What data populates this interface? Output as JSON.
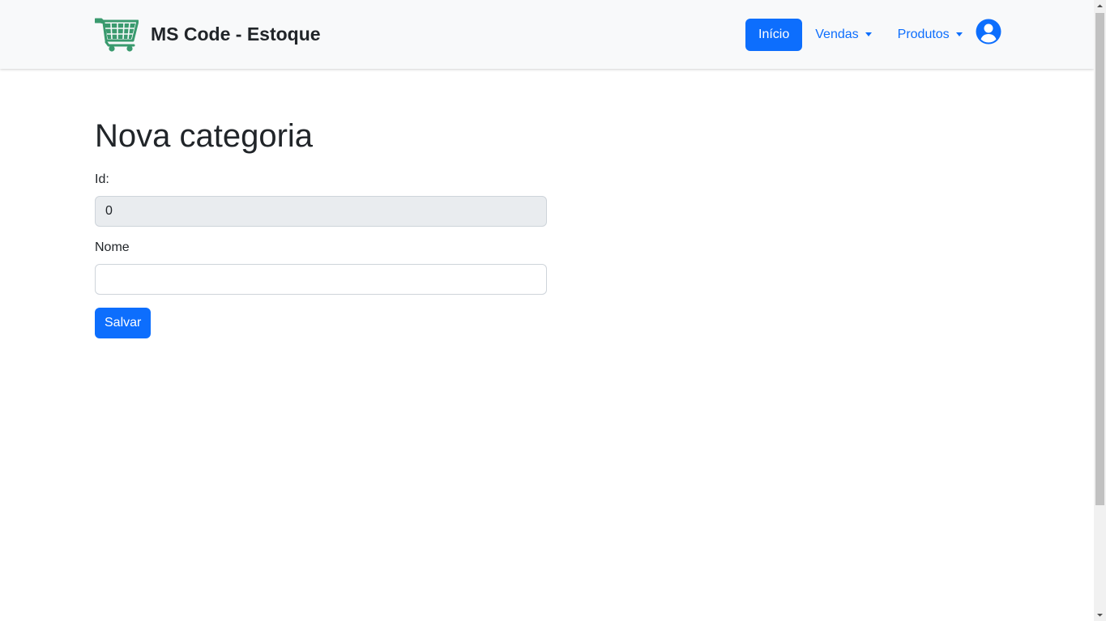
{
  "navbar": {
    "brand": "MS Code - Estoque",
    "brand_icon": "shopping-cart-icon",
    "items": [
      {
        "label": "Início",
        "active": true
      },
      {
        "label": "Vendas",
        "dropdown": true
      },
      {
        "label": "Produtos",
        "dropdown": true
      }
    ],
    "user_icon": "user-circle-icon"
  },
  "form": {
    "title": "Nova categoria",
    "id_label": "Id:",
    "id_value": "0",
    "nome_label": "Nome",
    "nome_value": "",
    "submit_label": "Salvar"
  },
  "colors": {
    "primary": "#0d6efd",
    "brand_green": "#198754",
    "navbar_bg": "#f8f9fa",
    "readonly_bg": "#e9ecef"
  }
}
